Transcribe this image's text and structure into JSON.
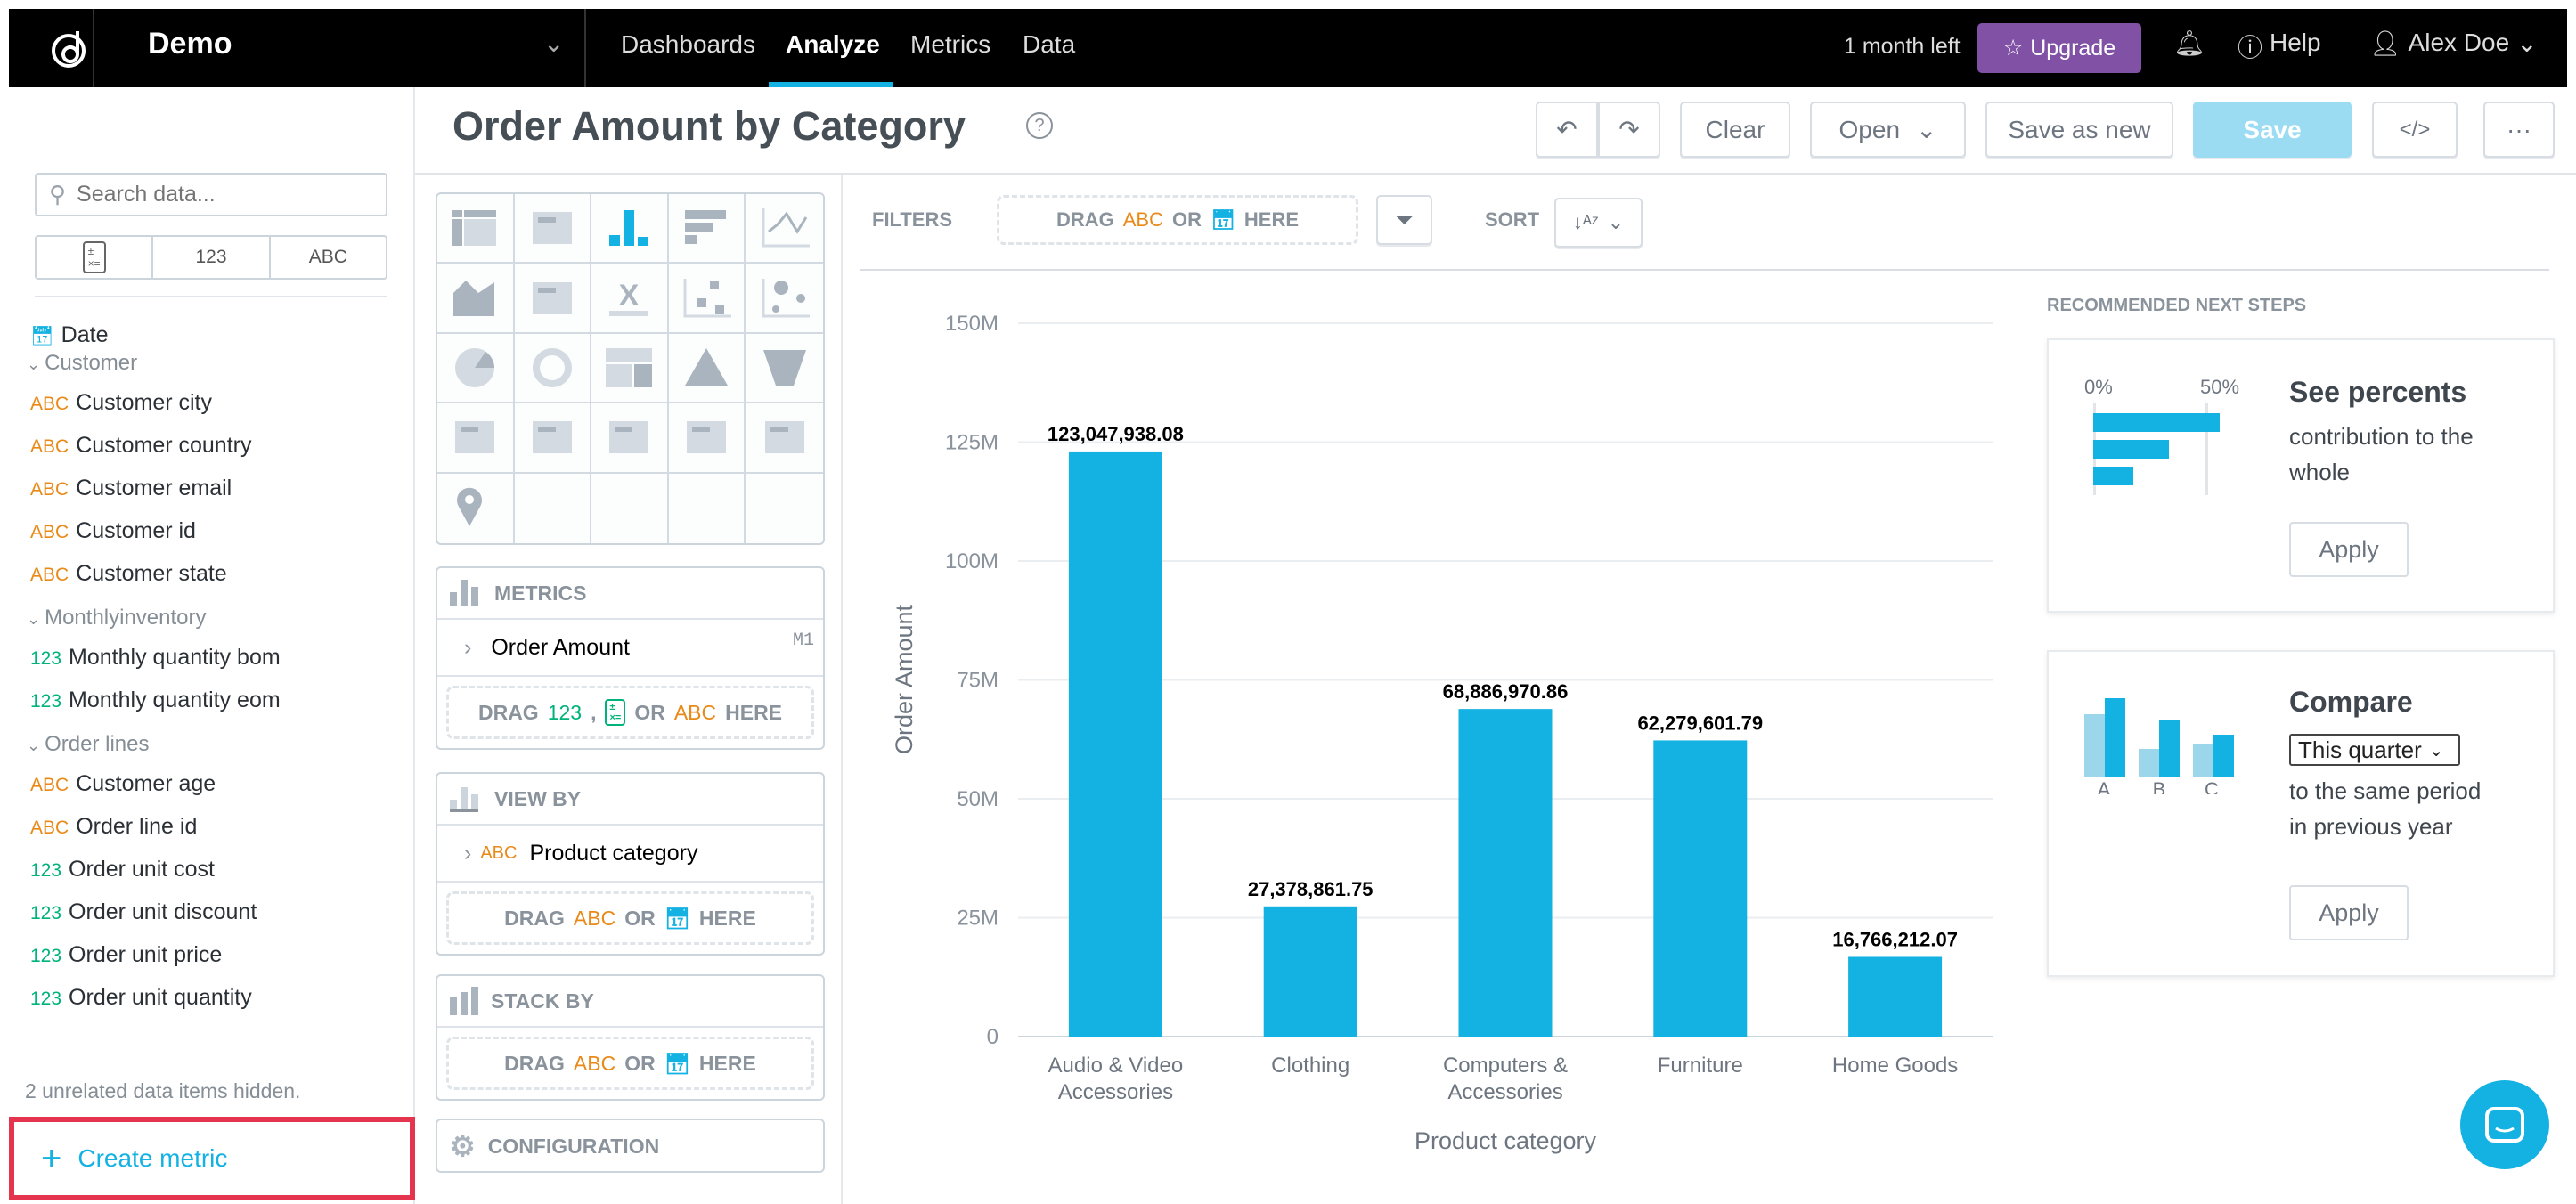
{
  "header": {
    "workspace": "Demo",
    "nav": [
      "Dashboards",
      "Analyze",
      "Metrics",
      "Data"
    ],
    "active_nav": "Analyze",
    "trial": "1 month left",
    "upgrade": "Upgrade",
    "help": "Help",
    "user": "Alex Doe",
    "upgrade_color": "#8151a6"
  },
  "toolbar": {
    "title": "Order Amount by Category",
    "clear": "Clear",
    "open": "Open",
    "save_as_new": "Save as new",
    "save": "Save",
    "code": "</>",
    "more": "···",
    "save_color": "#9cdcf3"
  },
  "sidebar": {
    "search_placeholder": "Search data...",
    "type_filters": [
      "123",
      "ABC"
    ],
    "items": [
      {
        "kind": "date",
        "label": "Date"
      },
      {
        "kind": "group",
        "label": "Customer"
      },
      {
        "kind": "abc",
        "label": "Customer city"
      },
      {
        "kind": "abc",
        "label": "Customer country"
      },
      {
        "kind": "abc",
        "label": "Customer email"
      },
      {
        "kind": "abc",
        "label": "Customer id"
      },
      {
        "kind": "abc",
        "label": "Customer state"
      },
      {
        "kind": "group",
        "label": "Monthlyinventory"
      },
      {
        "kind": "num",
        "label": "Monthly quantity bom"
      },
      {
        "kind": "num",
        "label": "Monthly quantity eom"
      },
      {
        "kind": "group",
        "label": "Order lines"
      },
      {
        "kind": "abc",
        "label": "Customer age"
      },
      {
        "kind": "abc",
        "label": "Order line id"
      },
      {
        "kind": "num",
        "label": "Order unit cost"
      },
      {
        "kind": "num",
        "label": "Order unit discount"
      },
      {
        "kind": "num",
        "label": "Order unit price"
      },
      {
        "kind": "num",
        "label": "Order unit quantity"
      }
    ],
    "hidden_note": "2 unrelated data items hidden.",
    "create_metric": "Create metric"
  },
  "buckets": {
    "metrics": {
      "title": "METRICS",
      "item": "Order Amount",
      "item_id": "M1"
    },
    "view_by": {
      "title": "VIEW BY",
      "item": "Product category"
    },
    "stack_by": {
      "title": "STACK BY"
    },
    "configuration": "CONFIGURATION",
    "drag": "DRAG",
    "or": "OR",
    "here": "HERE",
    "abc": "ABC",
    "num": "123",
    "comma": ","
  },
  "filters": {
    "label": "FILTERS",
    "sort_label": "SORT"
  },
  "chart_data": {
    "type": "bar",
    "categories": [
      "Audio & Video Accessories",
      "Clothing",
      "Computers & Accessories",
      "Furniture",
      "Home Goods"
    ],
    "values": [
      123047938.08,
      27378861.75,
      68886970.86,
      62279601.79,
      16766212.07
    ],
    "data_labels": [
      "123,047,938.08",
      "27,378,861.75",
      "68,886,970.86",
      "62,279,601.79",
      "16,766,212.07"
    ],
    "xlabel": "Product category",
    "ylabel": "Order Amount",
    "ylim": [
      0,
      150000000
    ],
    "yticks": [
      "0",
      "25M",
      "50M",
      "75M",
      "100M",
      "125M",
      "150M"
    ],
    "grid": true,
    "bar_color": "#14b2e2"
  },
  "recommendations": {
    "title": "RECOMMENDED NEXT STEPS",
    "percents": {
      "title": "See percents",
      "text1": "contribution to the",
      "text2": "whole",
      "apply": "Apply",
      "axis0": "0%",
      "axis50": "50%"
    },
    "compare": {
      "title": "Compare",
      "period": "This quarter",
      "text1": "to the same period",
      "text2": "in previous year",
      "apply": "Apply",
      "labels": [
        "A",
        "B",
        "C"
      ]
    }
  }
}
